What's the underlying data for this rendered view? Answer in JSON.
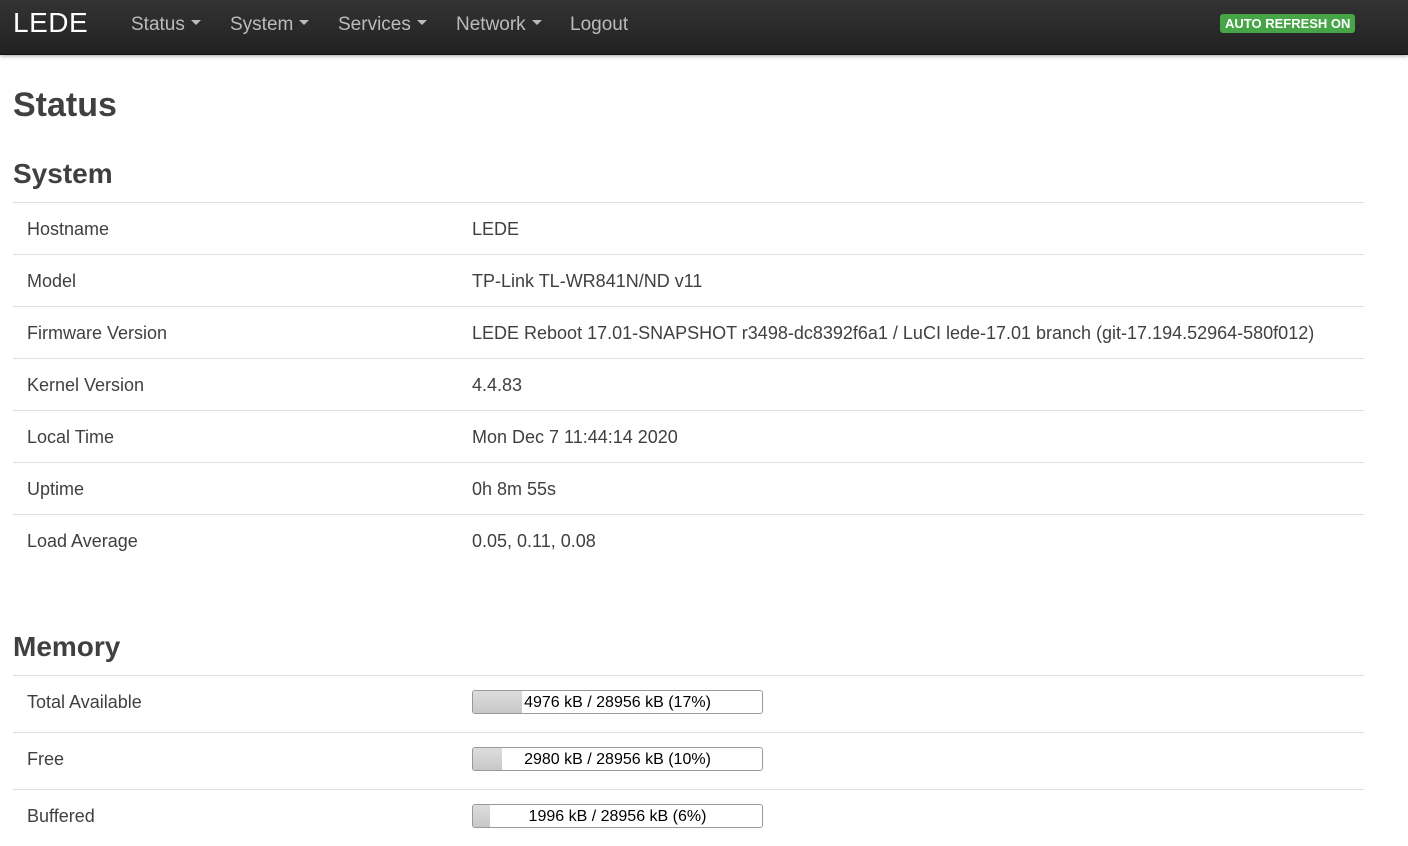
{
  "nav": {
    "brand": "LEDE",
    "items": [
      {
        "label": "Status"
      },
      {
        "label": "System"
      },
      {
        "label": "Services"
      },
      {
        "label": "Network"
      }
    ],
    "logout_label": "Logout",
    "auto_refresh_label": "AUTO REFRESH ON",
    "auto_refresh_color": "#46a546"
  },
  "page": {
    "title": "Status"
  },
  "system": {
    "title": "System",
    "rows": [
      {
        "label": "Hostname",
        "value": "LEDE"
      },
      {
        "label": "Model",
        "value": "TP-Link TL-WR841N/ND v11"
      },
      {
        "label": "Firmware Version",
        "value": "LEDE Reboot 17.01-SNAPSHOT r3498-dc8392f6a1 / LuCI lede-17.01 branch (git-17.194.52964-580f012)"
      },
      {
        "label": "Kernel Version",
        "value": "4.4.83"
      },
      {
        "label": "Local Time",
        "value": "Mon Dec 7 11:44:14 2020"
      },
      {
        "label": "Uptime",
        "value": "0h 8m 55s"
      },
      {
        "label": "Load Average",
        "value": "0.05, 0.11, 0.08"
      }
    ]
  },
  "memory": {
    "title": "Memory",
    "rows": [
      {
        "label": "Total Available",
        "text": "4976 kB / 28956 kB (17%)",
        "percent": 17
      },
      {
        "label": "Free",
        "text": "2980 kB / 28956 kB (10%)",
        "percent": 10
      },
      {
        "label": "Buffered",
        "text": "1996 kB / 28956 kB (6%)",
        "percent": 6
      }
    ]
  }
}
